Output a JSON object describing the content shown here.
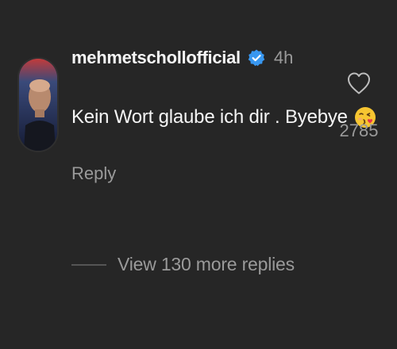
{
  "comment": {
    "username": "mehmetschollofficial",
    "time": "4h",
    "text": "Kein Wort glaube ich dir . Byebye",
    "reply_label": "Reply",
    "like_count": "2785",
    "verified": true,
    "emoji": "kissing-face-emoji"
  },
  "more_replies": {
    "label": "View 130 more replies"
  },
  "colors": {
    "background": "#262626",
    "text_primary": "#f5f5f5",
    "text_secondary": "#9a9a9a",
    "verified_blue": "#3897f0"
  },
  "icons": {
    "verified": "verified-badge-icon",
    "like": "heart-icon",
    "emoji": "kissing-face-emoji"
  }
}
